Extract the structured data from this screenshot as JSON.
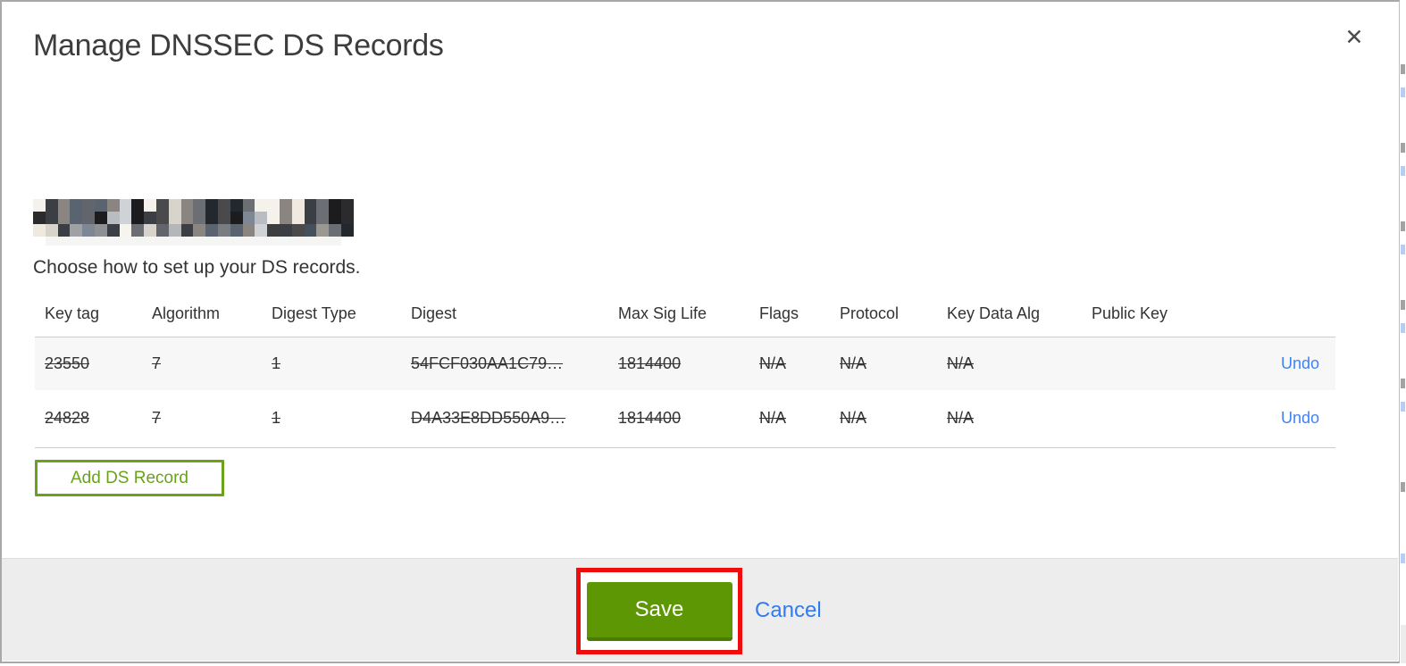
{
  "modal": {
    "title": "Manage DNSSEC DS Records",
    "close_icon": "✕",
    "domain": {
      "redacted": true
    },
    "subtitle": "Choose how to set up your DS records.",
    "table": {
      "columns": [
        "Key tag",
        "Algorithm",
        "Digest Type",
        "Digest",
        "Max Sig Life",
        "Flags",
        "Protocol",
        "Key Data Alg",
        "Public Key",
        ""
      ],
      "rows": [
        {
          "key_tag": "23550",
          "algorithm": "7",
          "digest_type": "1",
          "digest": "54FCF030AA1C79…",
          "max_sig_life": "1814400",
          "flags": "N/A",
          "protocol": "N/A",
          "key_data_alg": "N/A",
          "public_key": "",
          "action": "Undo",
          "struck": true
        },
        {
          "key_tag": "24828",
          "algorithm": "7",
          "digest_type": "1",
          "digest": "D4A33E8DD550A9…",
          "max_sig_life": "1814400",
          "flags": "N/A",
          "protocol": "N/A",
          "key_data_alg": "N/A",
          "public_key": "",
          "action": "Undo",
          "struck": true
        }
      ]
    },
    "add_button_label": "Add DS Record",
    "footer": {
      "save_label": "Save",
      "cancel_label": "Cancel"
    }
  },
  "colors": {
    "save_green": "#5d9804",
    "save_green_dark": "#4a7b03",
    "add_button_green": "#6aa21c",
    "link_blue": "#3f82f3",
    "cancel_blue": "#2f7bf5",
    "annotation_red": "#ee0c0c",
    "footer_bg": "#ededed",
    "row_stripe": "#f7f7f7",
    "text_dark": "#333333",
    "modal_border": "#a8a8a8"
  }
}
